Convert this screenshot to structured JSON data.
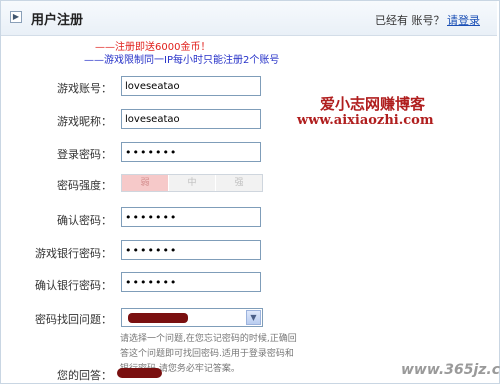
{
  "header": {
    "toggle_glyph": "▶",
    "title": "用户注册",
    "account_question": "已经有 账号？",
    "login_link": "请登录"
  },
  "notices": {
    "line1": "——注册即送6000金币！",
    "line2": "——游戏限制同一IP每小时只能注册2个账号"
  },
  "form": {
    "account_label": "游戏账号：",
    "account_value": "loveseatao",
    "nickname_label": "游戏昵称：",
    "nickname_value": "loveseatao",
    "password_label": "登录密码：",
    "password_value": "•••••••",
    "strength_label": "密码强度：",
    "strength_levels": [
      "弱",
      "中",
      "强"
    ],
    "strength_level_active": "弱",
    "confirm_label": "确认密码：",
    "confirm_value": "•••••••",
    "bank_label": "游戏银行密码：",
    "bank_value": "•••••••",
    "bank_confirm_label": "确认银行密码：",
    "bank_confirm_value": "•••••••",
    "question_label": "密码找回问题：",
    "question_hint": "请选择一个问题,在您忘记密码的时候,正确回答这个问题即可找回密码.适用于登录密码和银行密码,请您务必牢记答案。",
    "answer_label": "您的回答："
  },
  "brand": {
    "name": "爱小志网赚博客",
    "url": "www.aixiaozhi.com"
  },
  "watermark": "www.365jz.com"
}
